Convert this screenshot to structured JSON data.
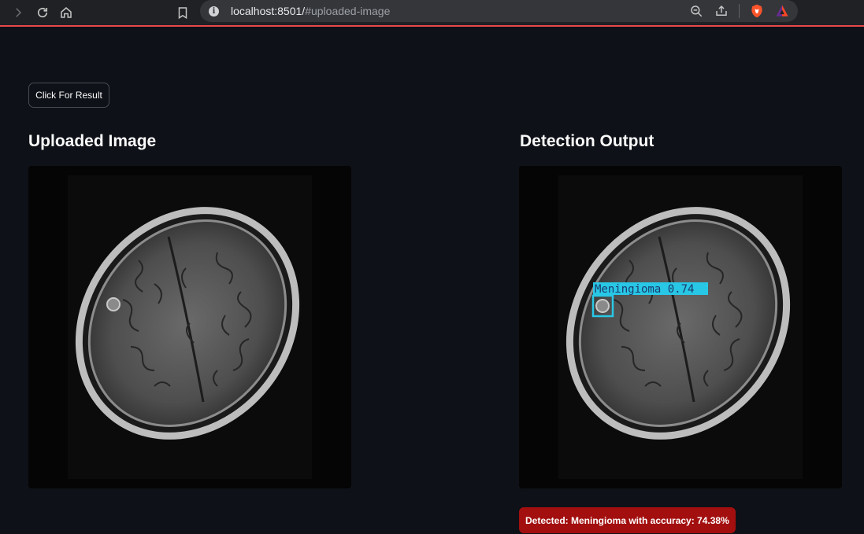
{
  "browser": {
    "url_host": "localhost:8501/",
    "url_path": "#uploaded-image",
    "icons": [
      "forward-icon",
      "reload-icon",
      "home-icon",
      "bookmark-icon",
      "site-info-icon",
      "zoom-icon",
      "share-icon",
      "brave-shield-icon",
      "brave-rewards-icon"
    ]
  },
  "app": {
    "result_button_label": "Click For Result",
    "uploaded_heading": "Uploaded Image",
    "detection_heading": "Detection Output",
    "detection_box_label": "Meningioma  0.74",
    "status_text": "Detected: Meningioma with accuracy: 74.38%",
    "colors": {
      "background": "#0e1117",
      "status_badge": "#a30f0f",
      "box_color": "#29c7e6"
    }
  }
}
